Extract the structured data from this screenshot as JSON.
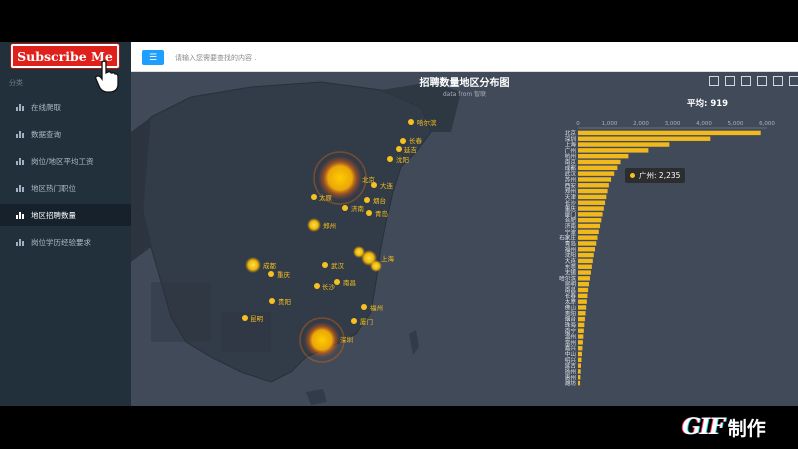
{
  "subscribe_label": "Subscribe Me",
  "header": {
    "menu_icon": "menu-icon",
    "search_placeholder": "请输入您需要查找的内容 ."
  },
  "sidebar": {
    "group_label": "分类",
    "items": [
      {
        "label": "在线爬取",
        "active": false
      },
      {
        "label": "数据查询",
        "active": false
      },
      {
        "label": "岗位/地区平均工资",
        "active": false
      },
      {
        "label": "地区热门职位",
        "active": false
      },
      {
        "label": "地区招聘数量",
        "active": true
      },
      {
        "label": "岗位学历经验要求",
        "active": false
      }
    ]
  },
  "chart": {
    "title": "招聘数量地区分布图",
    "subtitle": "data from 智联",
    "average_label": "平均: 919",
    "tooltip": {
      "city": "广州",
      "value": "2,235"
    },
    "accent": "#f7c11e",
    "map_bg": "#404a59"
  },
  "map_cities": [
    {
      "name": "哈尔滨",
      "size": "small"
    },
    {
      "name": "长春",
      "size": "small"
    },
    {
      "name": "延吉",
      "size": "small"
    },
    {
      "name": "沈阳",
      "size": "small"
    },
    {
      "name": "北京",
      "size": "large"
    },
    {
      "name": "大连",
      "size": "small"
    },
    {
      "name": "太原",
      "size": "small"
    },
    {
      "name": "济南",
      "size": "small"
    },
    {
      "name": "烟台",
      "size": "small"
    },
    {
      "name": "青岛",
      "size": "small"
    },
    {
      "name": "郑州",
      "size": "medium"
    },
    {
      "name": "成都",
      "size": "medium"
    },
    {
      "name": "武汉",
      "size": "small"
    },
    {
      "name": "上海",
      "size": "medium"
    },
    {
      "name": "重庆",
      "size": "small"
    },
    {
      "name": "长沙",
      "size": "small"
    },
    {
      "name": "南昌",
      "size": "small"
    },
    {
      "name": "贵阳",
      "size": "small"
    },
    {
      "name": "福州",
      "size": "small"
    },
    {
      "name": "昆明",
      "size": "small"
    },
    {
      "name": "厦门",
      "size": "small"
    },
    {
      "name": "深圳",
      "size": "large"
    }
  ],
  "chart_data": {
    "type": "bar",
    "orientation": "horizontal",
    "x_ticks": [
      "0",
      "1,000",
      "2,000",
      "3,000",
      "4,000",
      "5,000",
      "6,000"
    ],
    "xlim": [
      0,
      6000
    ],
    "categories": [
      "北京",
      "深圳",
      "上海",
      "广州",
      "杭州",
      "南京",
      "成都",
      "武汉",
      "苏州",
      "西安",
      "郑州",
      "天津",
      "长沙",
      "重庆",
      "厦门",
      "合肥",
      "济南",
      "宁波",
      "石家庄",
      "青岛",
      "福州",
      "沈阳",
      "大连",
      "东莞",
      "无锡",
      "哈尔滨",
      "昆明",
      "南昌",
      "长春",
      "太原",
      "佛山",
      "贵阳",
      "烟台",
      "珠海",
      "南宁",
      "温州",
      "常州",
      "嘉兴",
      "中山",
      "绍兴",
      "延吉",
      "扬州",
      "惠州",
      "潍坊"
    ],
    "values": [
      5800,
      4200,
      2900,
      2235,
      1600,
      1350,
      1250,
      1150,
      1050,
      980,
      940,
      900,
      860,
      820,
      780,
      740,
      700,
      660,
      620,
      580,
      540,
      500,
      470,
      440,
      410,
      380,
      350,
      320,
      300,
      280,
      260,
      240,
      220,
      200,
      185,
      170,
      155,
      140,
      125,
      110,
      95,
      85,
      75,
      65
    ],
    "color": "#f2b91d"
  },
  "watermark": {
    "gif": "GIF",
    "cn": "制作"
  }
}
